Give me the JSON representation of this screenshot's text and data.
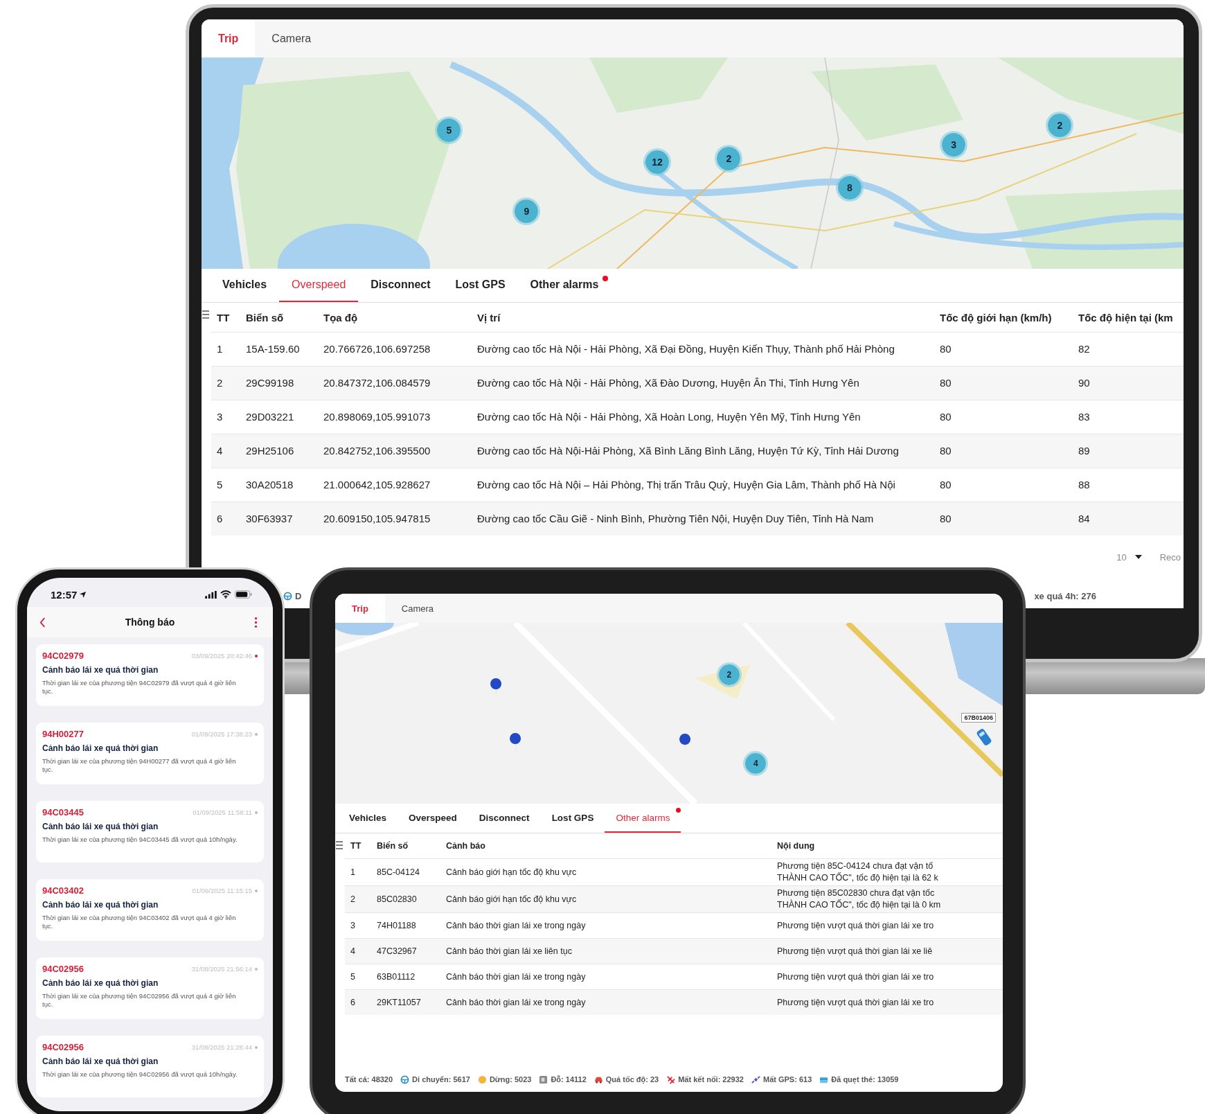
{
  "laptop": {
    "view_tabs": [
      {
        "label": "Trip",
        "selected": true
      },
      {
        "label": "Camera",
        "selected": false
      }
    ],
    "map": {
      "clusters": [
        "5",
        "12",
        "2",
        "9",
        "8",
        "3",
        "2"
      ]
    },
    "alarm_tabs": [
      {
        "label": "Vehicles",
        "selected": false,
        "alert": false
      },
      {
        "label": "Overspeed",
        "selected": true,
        "alert": false
      },
      {
        "label": "Disconnect",
        "selected": false,
        "alert": false
      },
      {
        "label": "Lost GPS",
        "selected": false,
        "alert": false
      },
      {
        "label": "Other alarms",
        "selected": false,
        "alert": true
      }
    ],
    "table": {
      "columns": [
        "TT",
        "Biển số",
        "Tọa độ",
        "Vị trí",
        "Tốc độ giới hạn (km/h)",
        "Tốc độ hiện tại (km"
      ],
      "rows": [
        [
          "1",
          "15A-159.60",
          "20.766726,106.697258",
          "Đường cao tốc Hà Nội - Hải Phòng, Xã Đại Đồng, Huyện Kiến Thụy, Thành phố Hải Phòng",
          "80",
          "82"
        ],
        [
          "2",
          "29C99198",
          "20.847372,106.084579",
          "Đường cao tốc Hà Nội - Hải Phòng, Xã Đào Dương, Huyện Ân Thi, Tỉnh Hưng Yên",
          "80",
          "90"
        ],
        [
          "3",
          "29D03221",
          "20.898069,105.991073",
          "Đường cao tốc Hà Nội - Hải Phòng, Xã Hoàn Long, Huyện Yên Mỹ, Tỉnh Hưng Yên",
          "80",
          "83"
        ],
        [
          "4",
          "29H25106",
          "20.842752,106.395500",
          "Đường cao tốc Hà Nội-Hải Phòng, Xã Bình Lăng Bình Lăng, Huyện Tứ Kỳ, Tỉnh Hải Dương",
          "80",
          "89"
        ],
        [
          "5",
          "30A20518",
          "21.000642,105.928627",
          "Đường cao tốc Hà Nội – Hải Phòng, Thị trấn Trâu Quỳ, Huyện Gia Lâm, Thành phố Hà Nội",
          "80",
          "88"
        ],
        [
          "6",
          "30F63937",
          "20.609150,105.947815",
          "Đường cao tốc Cầu Giẽ - Ninh Bình, Phường Tiên Nội, Huyện Duy Tiên, Tỉnh Hà Nam",
          "80",
          "84"
        ]
      ]
    },
    "pagination": {
      "page_size": "10",
      "records": "Reco"
    },
    "status_bar": [
      {
        "kind": "moving",
        "text": "D"
      },
      {
        "kind": "plain",
        "text": "xe quá 4h: 276"
      }
    ]
  },
  "tablet": {
    "view_tabs": [
      {
        "label": "Trip",
        "selected": true
      },
      {
        "label": "Camera",
        "selected": false
      }
    ],
    "map": {
      "clusters": [
        "2",
        "4"
      ],
      "vehicle_label": "67B01406"
    },
    "alarm_tabs": [
      {
        "label": "Vehicles",
        "selected": false,
        "alert": false
      },
      {
        "label": "Overspeed",
        "selected": false,
        "alert": false
      },
      {
        "label": "Disconnect",
        "selected": false,
        "alert": false
      },
      {
        "label": "Lost GPS",
        "selected": false,
        "alert": false
      },
      {
        "label": "Other alarms",
        "selected": true,
        "alert": true
      }
    ],
    "table": {
      "columns": [
        "TT",
        "Biển số",
        "Cảnh báo",
        "Nội dung"
      ],
      "rows": [
        [
          "1",
          "85C-04124",
          "Cảnh báo giới hạn tốc độ khu vực",
          "Phương tiện 85C-04124 chưa đạt vận tố\nTHÀNH CAO TỐC\", tốc độ hiện tại là 62 k"
        ],
        [
          "2",
          "85C02830",
          "Cảnh báo giới hạn tốc độ khu vực",
          "Phương tiện 85C02830 chưa đạt vận tốc\nTHÀNH CAO TỐC\", tốc độ hiện tại là 0 km"
        ],
        [
          "3",
          "74H01188",
          "Cảnh báo thời gian lái xe trong ngày",
          "Phương tiện vượt quá thời gian lái xe tro"
        ],
        [
          "4",
          "47C32967",
          "Cảnh báo thời gian lái xe liên tục",
          "Phương tiện vượt quá thời gian lái xe liê"
        ],
        [
          "5",
          "63B01112",
          "Cảnh báo thời gian lái xe trong ngày",
          "Phương tiện vượt quá thời gian lái xe tro"
        ],
        [
          "6",
          "29KT11057",
          "Cảnh báo thời gian lái xe trong ngày",
          "Phương tiện vượt quá thời gian lái xe tro"
        ]
      ]
    },
    "status_bar": [
      {
        "kind": "plain",
        "text": "Tất cả: 48320"
      },
      {
        "kind": "moving",
        "text": "Di chuyển: 5617"
      },
      {
        "kind": "stopped",
        "text": "Dừng: 5023"
      },
      {
        "kind": "parked",
        "text": "Đỗ: 14112"
      },
      {
        "kind": "overspeed",
        "text": "Quá tốc độ: 23"
      },
      {
        "kind": "disconnected",
        "text": "Mất kết nối: 22932"
      },
      {
        "kind": "lost_gps",
        "text": "Mất GPS: 613"
      },
      {
        "kind": "card",
        "text": "Đã quẹt thẻ: 13059"
      }
    ]
  },
  "phone": {
    "time": "12:57",
    "title": "Thông báo",
    "notifications": [
      {
        "plate": "94C02979",
        "time": "03/09/2025 20:42:46",
        "unread": true,
        "title": "Cảnh báo lái xe quá thời gian",
        "body": "Thời gian lái xe của phương tiện 94C02979 đã vượt quá 4 giờ liên tục."
      },
      {
        "plate": "94H00277",
        "time": "01/09/2025 17:38:23",
        "unread": false,
        "title": "Cảnh báo lái xe quá thời gian",
        "body": "Thời gian lái xe của phương tiện 94H00277 đã vượt quá 4 giờ liên tục."
      },
      {
        "plate": "94C03445",
        "time": "01/09/2025 11:58:11",
        "unread": false,
        "title": "Cảnh báo lái xe quá thời gian",
        "body": "Thời gian lái xe của phương tiện 94C03445 đã vượt quá 10h/ngày."
      },
      {
        "plate": "94C03402",
        "time": "01/09/2025 11:15:15",
        "unread": false,
        "title": "Cảnh báo lái xe quá thời gian",
        "body": "Thời gian lái xe của phương tiện 94C03402 đã vượt quá 4 giờ liên tục."
      },
      {
        "plate": "94C02956",
        "time": "31/08/2025 21:56:14",
        "unread": false,
        "title": "Cảnh báo lái xe quá thời gian",
        "body": "Thời gian lái xe của phương tiện 94C02956 đã vượt quá 4 giờ liên tục."
      },
      {
        "plate": "94C02956",
        "time": "31/08/2025 21:28:44",
        "unread": false,
        "title": "Cảnh báo lái xe quá thời gian",
        "body": "Thời gian lái xe của phương tiện 94C02956 đã vượt quá 10h/ngày."
      }
    ]
  }
}
